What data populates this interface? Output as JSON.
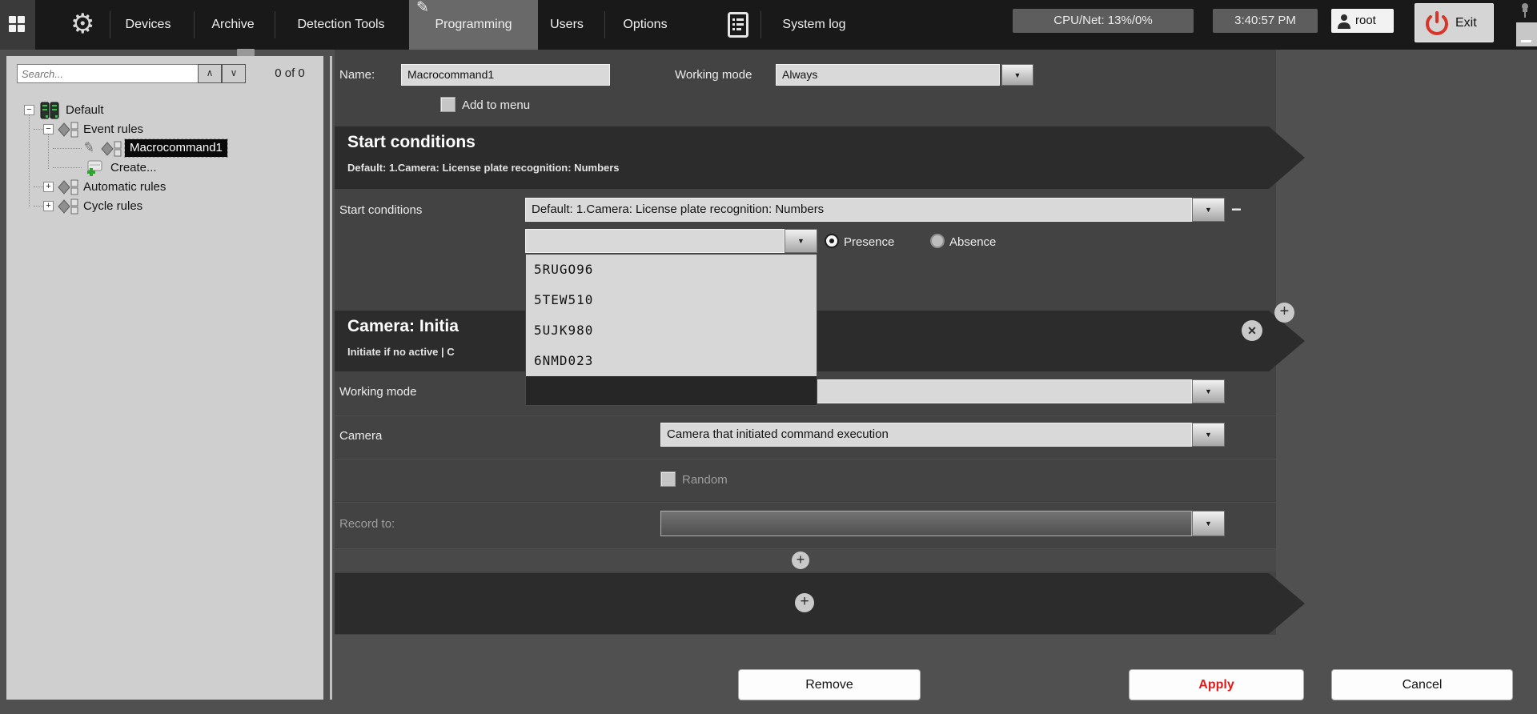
{
  "colors": {
    "topbar_bg": "#191919",
    "content_bg": "#434343",
    "panel_bg": "#cfcfcf",
    "band_bg": "#2c2c2c",
    "field_bg": "#d9d9d9",
    "accent_red": "#e01b1b",
    "selection_bg": "#0a0a0a",
    "dim_label": "#9d9d9d"
  },
  "glyphs": {
    "down_triangle": "▼",
    "chevron_up": "∧",
    "chevron_down": "∨",
    "plus": "+",
    "minus": "−",
    "close": "✕",
    "gear": "⚙",
    "pencil": "✎",
    "expand_open": "−",
    "expand_closed": "+"
  },
  "topbar": {
    "menu": [
      "Devices",
      "Archive",
      "Detection Tools",
      "Programming",
      "Users",
      "Options",
      "System log"
    ],
    "active_item": "Programming",
    "cpu_net": "CPU/Net: 13%/0%",
    "clock": "3:40:57 PM",
    "user": "root",
    "exit": "Exit"
  },
  "sidebar": {
    "search_placeholder": "Search...",
    "result_count": "0 of 0",
    "tree": {
      "items": [
        {
          "label": "Default"
        },
        {
          "label": "Event rules"
        },
        {
          "label": "Macrocommand1",
          "selected": true
        },
        {
          "label": "Create..."
        },
        {
          "label": "Automatic rules"
        },
        {
          "label": "Cycle rules"
        }
      ]
    }
  },
  "form": {
    "name_label": "Name:",
    "name_value": "Macrocommand1",
    "working_mode_label": "Working mode",
    "working_mode_value": "Always",
    "add_to_menu_label": "Add to menu"
  },
  "start_conditions": {
    "header_title": "Start conditions",
    "header_subtitle": "Default: 1.Camera: License plate recognition: Numbers",
    "row_label": "Start conditions",
    "selected_condition": "Default: 1.Camera: License plate recognition: Numbers",
    "combo_value": "",
    "presence_label": "Presence",
    "absence_label": "Absence",
    "dropdown_items": [
      "5RUGO96",
      "5TEW510",
      "5UJK980",
      "6NMD023"
    ]
  },
  "camera_action": {
    "header_title": "Camera: Initia",
    "header_subtitle": "Initiate if no active | C",
    "working_mode_label": "Working mode",
    "working_mode_value": "",
    "camera_label": "Camera",
    "camera_value": "Camera that initiated command execution",
    "random_label": "Random",
    "record_to_label": "Record to:",
    "record_to_value": ""
  },
  "footer": {
    "remove_label": "Remove",
    "apply_label": "Apply",
    "cancel_label": "Cancel"
  }
}
